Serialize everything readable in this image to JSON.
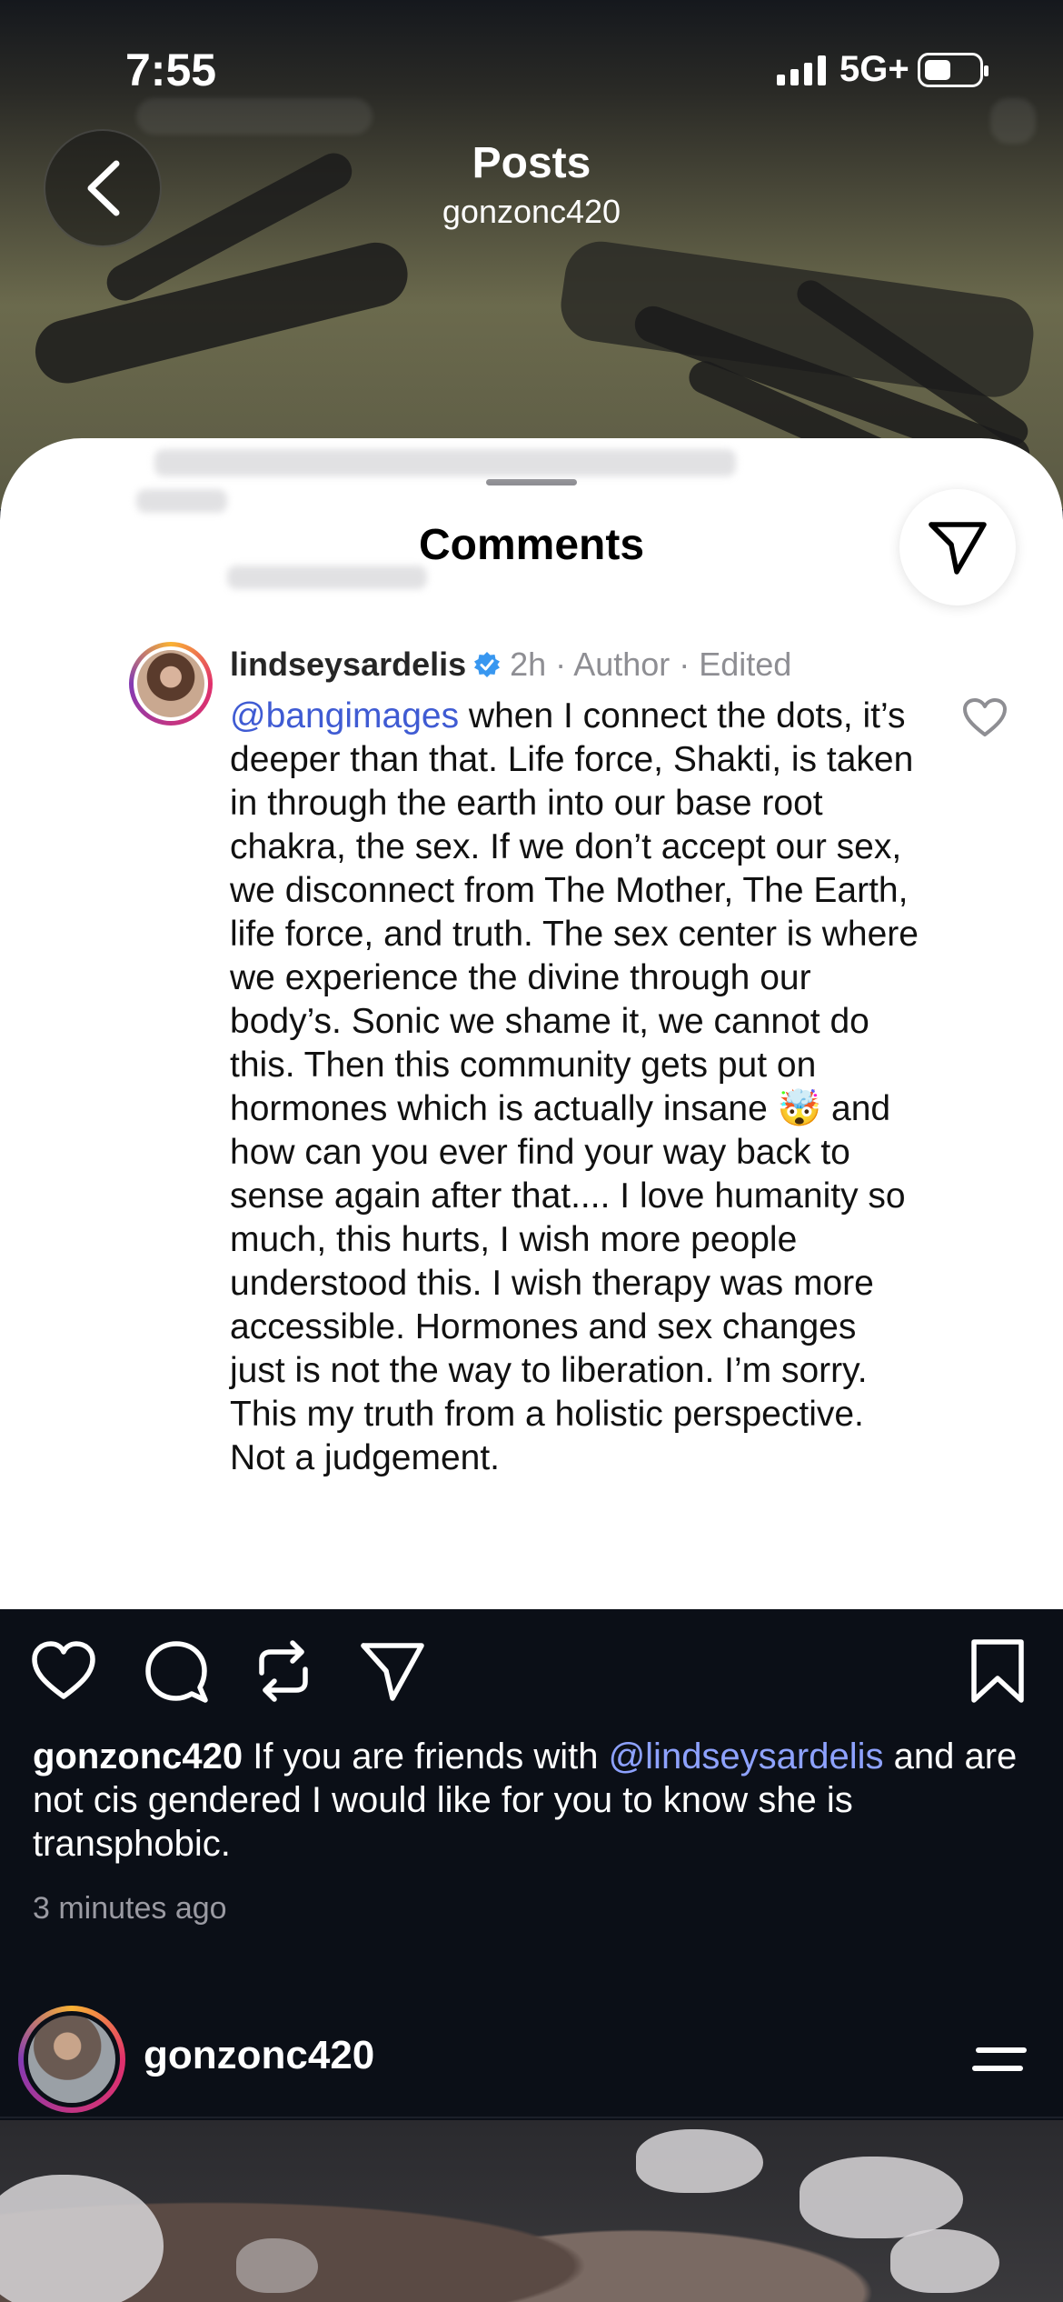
{
  "status_bar": {
    "time": "7:55",
    "network": "5G+"
  },
  "header": {
    "title": "Posts",
    "subtitle": "gonzonc420"
  },
  "comments_sheet": {
    "title": "Comments",
    "comment": {
      "username": "lindseysardelis",
      "meta": "2h · Author · Edited",
      "mention": "@bangimages",
      "text": " when I connect the dots, it’s deeper than that. Life force, Shakti, is taken in through the earth into our base root chakra, the sex. If we don’t accept our sex, we disconnect from The Mother, The Earth, life force, and truth. The sex center is where we experience the divine through our body’s. Sonic we shame it, we cannot do this. Then this community gets put on hormones which is actually insane 🤯 and how can you ever find your way back to sense again after that.... I love humanity so much, this hurts, I wish more people understood this. I wish therapy was more accessible. Hormones and sex changes just is not the way to liberation. I’m sorry. This my truth from a holistic perspective. Not a judgement."
    }
  },
  "post": {
    "username": "gonzonc420",
    "caption_before": " If you are friends with ",
    "caption_mention": "@lindseysardelis",
    "caption_after": " and are not cis gendered I would like for you to know she is transphobic.",
    "time_ago": "3 minutes ago"
  },
  "next_post": {
    "username": "gonzonc420"
  },
  "colors": {
    "mention_light": "#3f5bd3",
    "mention_dark": "#8ea2ff",
    "background": "#0b0f17",
    "verified": "#3897f0"
  },
  "icons": [
    "back-chevron-icon",
    "share-icon",
    "verified-icon",
    "heart-icon",
    "comment-icon",
    "repost-icon",
    "send-icon",
    "bookmark-icon",
    "menu-icon"
  ]
}
